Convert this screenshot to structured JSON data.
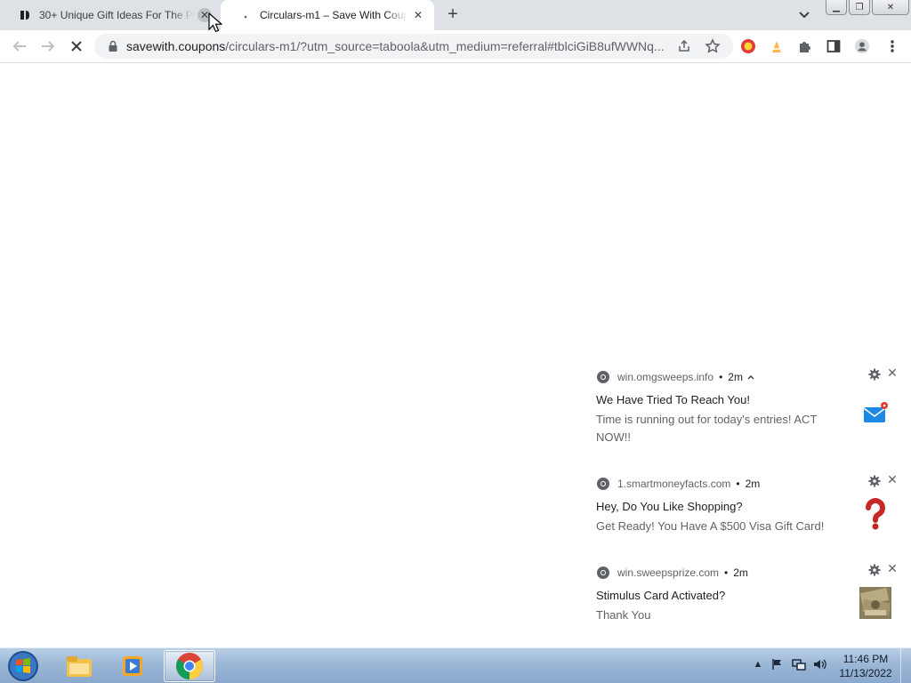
{
  "browser": {
    "tabs": [
      {
        "title": "30+ Unique Gift Ideas For The Pe",
        "active": false
      },
      {
        "title": "Circulars-m1 – Save With Coupo",
        "active": true
      }
    ],
    "new_tab_label": "+",
    "address_bar": {
      "host": "savewith.coupons",
      "path": "/circulars-m1/?utm_source=taboola&utm_medium=referral#tblciGiB8ufWWNq..."
    },
    "toolbar_icons": [
      "back-icon",
      "forward-icon",
      "stop-loading-icon",
      "lock-icon",
      "share-icon",
      "bookmark-star-icon",
      "extension-red-icon",
      "extension-cone-icon",
      "extensions-puzzle-icon",
      "side-panel-icon",
      "profile-icon",
      "menu-dots-icon"
    ]
  },
  "notifications": [
    {
      "source": "win.omgsweeps.info",
      "time": "2m",
      "title": "We Have Tried To Reach You!",
      "body": "Time is running out for today's entries! ACT NOW!!",
      "image": "mail-badge-icon"
    },
    {
      "source": "1.smartmoneyfacts.com",
      "time": "2m",
      "title": "Hey, Do You Like Shopping?",
      "body": "Get Ready! You Have A $500 Visa Gift Card!",
      "image": "question-mark-icon"
    },
    {
      "source": "win.sweepsprize.com",
      "time": "2m",
      "title": "Stimulus Card Activated?",
      "body": "Thank You",
      "image": "money-photo"
    }
  ],
  "taskbar": {
    "items": [
      "start-orb",
      "explorer-icon",
      "media-player-icon",
      "chrome-icon"
    ],
    "clock": {
      "time": "11:46 PM",
      "date": "11/13/2022"
    }
  },
  "colors": {
    "tabstrip": "#dee1e6",
    "omnibox": "#f1f3f4",
    "taskbar": "#9cb7d6",
    "mail_blue": "#1e88e5",
    "question_red": "#c62828"
  }
}
